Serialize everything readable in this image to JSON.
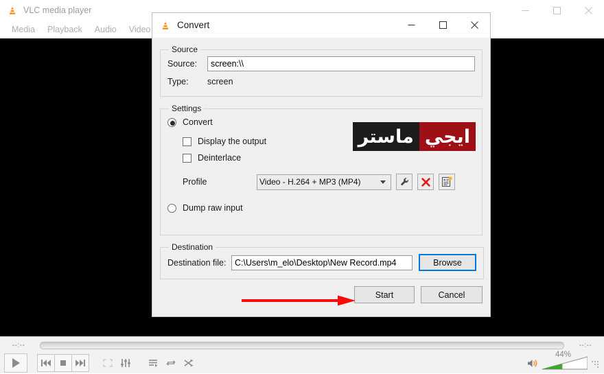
{
  "vlc": {
    "title": "VLC media player",
    "app_icon": "vlc-cone-icon",
    "menu": [
      "Media",
      "Playback",
      "Audio",
      "Video"
    ],
    "window_buttons": {
      "minimize": "minimize-icon",
      "maximize": "maximize-icon",
      "close": "close-icon"
    },
    "player": {
      "time_elapsed": "--:--",
      "time_total": "--:--",
      "seek_position_percent": 0,
      "volume_percent": "44%",
      "volume_value": 44,
      "volume_fill_color": "#3fa62e",
      "controls": [
        {
          "name": "play-button",
          "icon": "play-icon"
        },
        {
          "name": "previous-button",
          "icon": "previous-track-icon"
        },
        {
          "name": "stop-button",
          "icon": "stop-icon"
        },
        {
          "name": "next-button",
          "icon": "next-track-icon"
        },
        {
          "name": "fullscreen-button",
          "icon": "fullscreen-icon"
        },
        {
          "name": "equalizer-button",
          "icon": "equalizer-icon"
        },
        {
          "name": "playlist-button",
          "icon": "playlist-icon"
        },
        {
          "name": "loop-button",
          "icon": "loop-icon"
        },
        {
          "name": "shuffle-button",
          "icon": "shuffle-icon"
        }
      ]
    }
  },
  "dialog": {
    "title": "Convert",
    "icon": "vlc-cone-icon",
    "window_buttons": {
      "minimize": "minimize-icon",
      "maximize": "maximize-icon",
      "close": "close-icon"
    },
    "source": {
      "legend": "Source",
      "source_label": "Source:",
      "source_value": "screen:\\\\",
      "source_placeholder": "",
      "type_label": "Type:",
      "type_value": "screen"
    },
    "settings": {
      "legend": "Settings",
      "convert_radio": {
        "label": "Convert",
        "selected": true
      },
      "display_output_checkbox": {
        "label": "Display the output",
        "checked": false
      },
      "deinterlace_checkbox": {
        "label": "Deinterlace",
        "checked": false
      },
      "profile_label": "Profile",
      "profile_value": "Video - H.264 + MP3 (MP4)",
      "profile_options": [
        "Video - H.264 + MP3 (MP4)"
      ],
      "profile_buttons": [
        {
          "name": "edit-profile-button",
          "icon": "wrench-icon"
        },
        {
          "name": "delete-profile-button",
          "icon": "red-x-icon"
        },
        {
          "name": "new-profile-button",
          "icon": "new-profile-icon"
        }
      ],
      "dump_raw_radio": {
        "label": "Dump raw input",
        "selected": false
      }
    },
    "destination": {
      "legend": "Destination",
      "file_label": "Destination file:",
      "file_value": "C:\\Users\\m_elo\\Desktop\\New Record.mp4",
      "browse_label": "Browse"
    },
    "actions": {
      "start_label": "Start",
      "cancel_label": "Cancel"
    },
    "annotation": {
      "name": "red-arrow",
      "color": "#fa0a0a",
      "points_to": "Start"
    }
  },
  "watermark": {
    "text_right": "ايجي",
    "text_left": "ماستر",
    "red_color": "#9e1016",
    "black_color": "#1c1c1c"
  }
}
